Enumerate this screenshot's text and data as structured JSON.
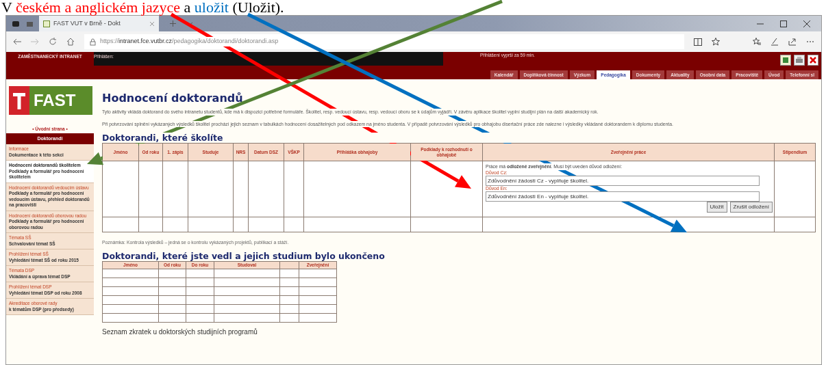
{
  "caption": {
    "parts": [
      {
        "text": "V ",
        "color": "#000000"
      },
      {
        "text": "českém a anglickém jazyce",
        "color": "#ff0000"
      },
      {
        "text": " a ",
        "color": "#000000"
      },
      {
        "text": "uložit",
        "color": "#0070c0"
      },
      {
        "text": " (Uložit).",
        "color": "#000000"
      }
    ]
  },
  "browser": {
    "tab_title": "FAST VUT v Brně - Dokt",
    "url_prefix": "https://",
    "url_host": "intranet.fce.vutbr.cz",
    "url_path": "/pedagogika/doktorandi/doktorandi.asp"
  },
  "header": {
    "brand": "ZAMĚSTNANECKÝ INTRANET",
    "login_label": "Přihlášen:",
    "session": "Přihlášení vyprší za 59 min.",
    "tabs": [
      {
        "label": "Kalendář",
        "selected": false
      },
      {
        "label": "Doplňková činnost",
        "selected": false
      },
      {
        "label": "Výzkum",
        "selected": false
      },
      {
        "label": "Pedagogika",
        "selected": true
      },
      {
        "label": "Dokumenty",
        "selected": false
      },
      {
        "label": "Aktuality",
        "selected": false
      },
      {
        "label": "Osobní data",
        "selected": false
      },
      {
        "label": "Pracoviště",
        "selected": false
      },
      {
        "label": "Úvod",
        "selected": false
      },
      {
        "label": "Telefonní sl",
        "selected": false
      }
    ]
  },
  "sidebar": {
    "logo": "FAST",
    "home_link": "• Úvodní strana •",
    "section": "Doktorandi",
    "items": [
      {
        "title": "Informace",
        "description": "Dokumentace k této sekci",
        "selected": false
      },
      {
        "title": "Hodnocení doktorandů školitelem",
        "description": "Podklady a formulář pro hodnocení školitelem",
        "selected": true
      },
      {
        "title": "Hodnocení doktorandů vedoucím ústavu",
        "description": "Podklady a formulář pro hodnocení vedoucím ústavu, přehled doktorandů na pracovišti",
        "selected": false
      },
      {
        "title": "Hodnocení doktorandů oborovou radou",
        "description": "Podklady a formulář pro hodnocení oborovou radou",
        "selected": false
      },
      {
        "title": "Témata SŠ",
        "description": "Schvalování témat SŠ",
        "selected": false
      },
      {
        "title": "Prohlížení témat SŠ",
        "description": "Vyhledání témat SŠ od roku 2015",
        "selected": false
      },
      {
        "title": "Témata DSP",
        "description": "Vkládání a úprava témat DSP",
        "selected": false
      },
      {
        "title": "Prohlížení témat DSP",
        "description": "Vyhledání témat DSP od roku 2008",
        "selected": false
      },
      {
        "title": "Akreditace oborové rady",
        "description": "k tématům DSP (pro předsedy)",
        "selected": false
      }
    ]
  },
  "main": {
    "title": "Hodnocení doktorandů",
    "paragraphs": [
      "Tyto aktivity vkládá doktorand do svého intranetu studentů, kde má k dispozici potřebné formuláře. Školitel, resp. vedoucí ústavu, resp. vedoucí oboru se k údajům vyjádří. V závěru aplikace školitel vyplní studijní plán na další akademický rok.",
      "Při potvrzování splnění vykázaných výsledků školitel prochází jejich seznam v tabulkách hodnocení dosažitelných pod odkazem na jméno studenta. V případě potvrzování výsledků pro obhajobu disertační práce zde nalezne i výsledky vkládané doktorandem k diplomu studenta."
    ],
    "table1": {
      "heading": "Doktorandi, které školíte",
      "columns": [
        "Jméno",
        "Od roku",
        "1. zápis",
        "Studuje",
        "NRS",
        "Datum DSZ",
        "VŠKP",
        "Přihláška obhajoby",
        "Podklady k rozhodnutí o obhajobě",
        "Zveřejnění práce",
        "Stipendium"
      ],
      "publication_form": {
        "notice": "Práce má **odložené zveřejnění**. Musí být uveden důvod odložení:",
        "fields": [
          {
            "label": "Důvod Cz:",
            "value": "Zdůvodnění žádosti Cz - vyplňuje školitel."
          },
          {
            "label": "Důvod En:",
            "value": "Zdůvodnění žádosti En - vyplňuje školitel."
          }
        ],
        "buttons": [
          "Uložit",
          "Zrušit odložení"
        ]
      }
    },
    "note": "Poznámka: Kontrola výsledků – jedná se o kontrolu vykázaných projektů, publikací a stáží.",
    "table2": {
      "heading": "Doktorandi, které jste vedl a jejich studium bylo ukončeno",
      "columns": [
        "Jméno",
        "Od roku",
        "Do roku",
        "Studoval",
        "",
        "Zveřejnění"
      ]
    },
    "footer_link": "Seznam zkratek u doktorských studijních programů"
  },
  "arrows": [
    {
      "color": "#ff0000"
    },
    {
      "color": "#548235"
    },
    {
      "color": "#0070c0"
    }
  ]
}
